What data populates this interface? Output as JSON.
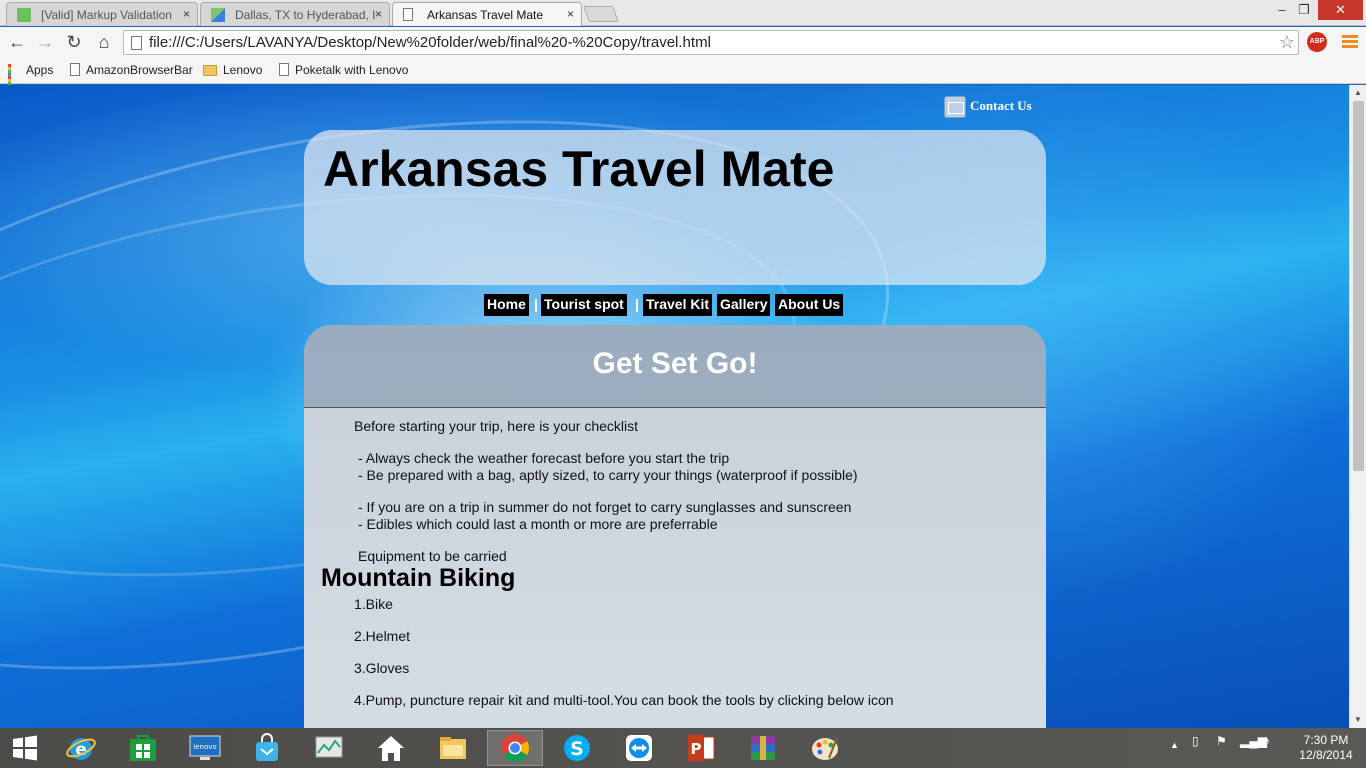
{
  "browser": {
    "tabs": [
      {
        "title": "[Valid] Markup Validation",
        "active": false,
        "icon": "green-square-icon"
      },
      {
        "title": "Dallas, TX to Hyderabad, I",
        "active": false,
        "icon": "map-icon"
      },
      {
        "title": "Arkansas Travel Mate",
        "active": true,
        "icon": "page-icon"
      }
    ],
    "close_glyph": "×",
    "window_controls": {
      "minimize": "‒",
      "restore": "❐",
      "close": "✕"
    },
    "url": "file:///C:/Users/LAVANYA/Desktop/New%20folder/web/final%20-%20Copy/travel.html",
    "abp_label": "ABP",
    "bookmarks": [
      "Apps",
      "AmazonBrowserBar",
      "Lenovo",
      "Poketalk with Lenovo"
    ]
  },
  "page": {
    "contact_label": "Contact Us",
    "site_title": "Arkansas Travel Mate",
    "nav": [
      "Home",
      "Tourist spot",
      "Travel Kit",
      "Gallery",
      "About Us"
    ],
    "nav_separator": "|",
    "section_title": "Get Set Go!",
    "intro": "Before starting your trip, here is your checklist",
    "checklist": [
      "- Always check the weather forecast before you start the trip",
      "- Be prepared with a bag, aptly sized, to carry your things (waterproof if possible)",
      "- If you are on a trip in summer do not forget to carry sunglasses and sunscreen",
      "- Edibles which could last a month or more are preferrable"
    ],
    "equipment_label": "Equipment to be carried",
    "activity_title": "Mountain Biking",
    "equipment_items": [
      "1.Bike",
      "2.Helmet",
      "3.Gloves",
      "4.Pump, puncture repair kit and multi-tool.You can book the tools by clicking below icon"
    ]
  },
  "taskbar": {
    "apps": [
      "start-icon",
      "internet-explorer-icon",
      "store-icon",
      "lenovo-icon",
      "shopping-bag-icon",
      "performance-monitor-icon",
      "home-icon",
      "file-explorer-icon",
      "chrome-icon",
      "skype-icon",
      "teamviewer-icon",
      "powerpoint-icon",
      "winrar-icon",
      "paint-icon"
    ],
    "time": "7:30 PM",
    "date": "12/8/2014"
  },
  "colors": {
    "nav_bg": "#000000",
    "nav_text": "#ffffff",
    "title_text": "#000000",
    "section_title_text": "#ffffff"
  }
}
